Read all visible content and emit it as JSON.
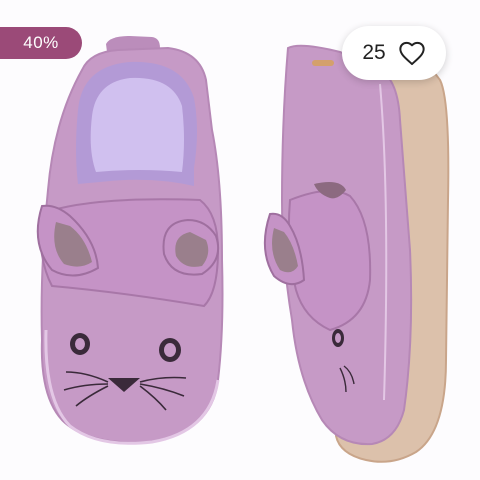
{
  "badge": {
    "discount_label": "40%"
  },
  "favorite": {
    "count": "25",
    "icon": "heart-outline-icon"
  },
  "product": {
    "image": "lilac-mouse-baby-shoes",
    "color": "#c69ac6"
  },
  "colors": {
    "badge_bg": "#9b4a78",
    "badge_text": "#ffffff",
    "pill_bg": "#ffffff"
  }
}
